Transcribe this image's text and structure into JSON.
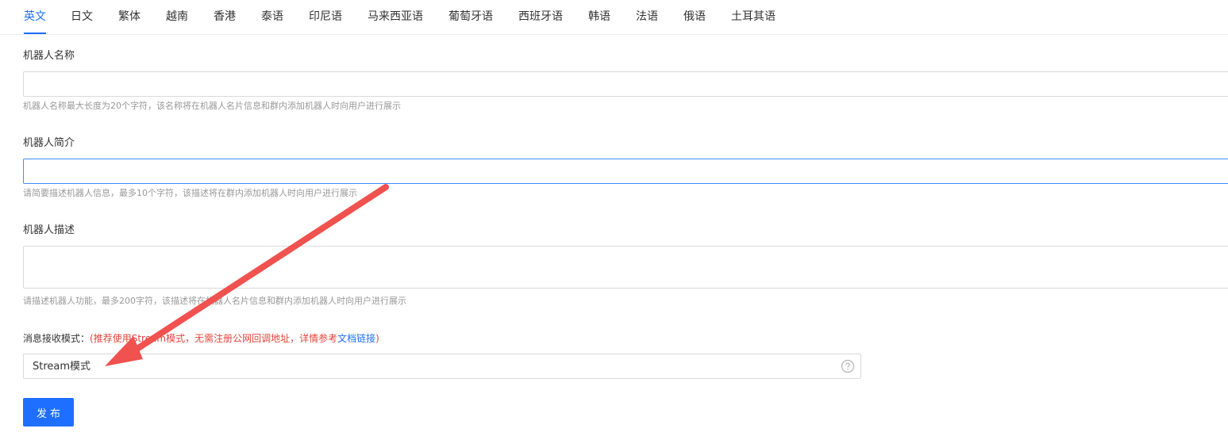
{
  "tabs": {
    "items": [
      {
        "label": "英文"
      },
      {
        "label": "日文"
      },
      {
        "label": "繁体"
      },
      {
        "label": "越南"
      },
      {
        "label": "香港"
      },
      {
        "label": "泰语"
      },
      {
        "label": "印尼语"
      },
      {
        "label": "马来西亚语"
      },
      {
        "label": "葡萄牙语"
      },
      {
        "label": "西班牙语"
      },
      {
        "label": "韩语"
      },
      {
        "label": "法语"
      },
      {
        "label": "俄语"
      },
      {
        "label": "土耳其语"
      }
    ],
    "active": "英文"
  },
  "form": {
    "name": {
      "label": "机器人名称",
      "value": "",
      "hint": "机器人名称最大长度为20个字符，该名称将在机器人名片信息和群内添加机器人时向用户进行展示"
    },
    "intro": {
      "label": "机器人简介",
      "value": "",
      "hint": "请简要描述机器人信息，最多10个字符，该描述将在群内添加机器人时向用户进行展示"
    },
    "description": {
      "label": "机器人描述",
      "value": "",
      "hint": "请描述机器人功能，最多200字符，该描述将在机器人名片信息和群内添加机器人时向用户进行展示"
    },
    "receive_mode": {
      "label": "消息接收模式：",
      "note_prefix": "(推荐使用Stream模式，无需注册公网回调地址，详情参考",
      "link_text": "文档链接",
      "note_suffix": ")",
      "selected": "Stream模式",
      "help_icon": "question-circle-icon"
    }
  },
  "actions": {
    "publish_label": "发布"
  },
  "annotation": {
    "arrow_color": "#f0524f"
  },
  "colors": {
    "accent": "#1e6fff",
    "warning_text": "#e5453c"
  }
}
